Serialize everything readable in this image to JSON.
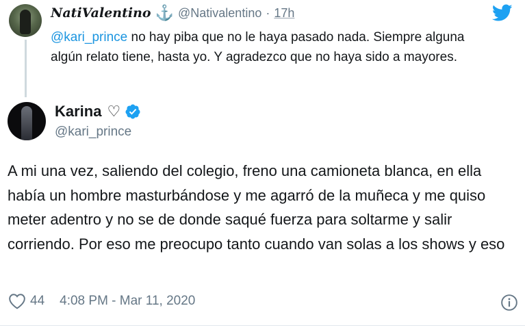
{
  "reply": {
    "display_name": "NatiValentino",
    "handle": "@Nativalentino",
    "separator": "·",
    "time": "17h",
    "mention": "@kari_prince",
    "text": " no hay piba que no le haya pasado nada. Siempre alguna algún relato tiene, hasta yo. Y agradezco que no haya sido a mayores."
  },
  "tweet": {
    "display_name": "Karina",
    "name_emoji": "♡",
    "handle": "@kari_prince",
    "text": "A mi una vez, saliendo del colegio, freno una camioneta blanca, en ella había un hombre masturbándose y me agarró de la muñeca y me quiso meter adentro y no se de donde saqué fuerza para soltarme y salir corriendo. Por eso me preocupo tanto cuando van solas a los shows y eso",
    "like_count": "44",
    "timestamp": "4:08 PM - Mar 11, 2020"
  },
  "icons": {
    "brand": "twitter-bird-icon",
    "verified": "verified-badge-icon",
    "like": "heart-outline-icon",
    "info": "info-icon",
    "anchor": "anchor-icon"
  },
  "colors": {
    "twitter_blue": "#1da1f2",
    "link_blue": "#1b95e0",
    "secondary_text": "#657786",
    "primary_text": "#14171a"
  }
}
